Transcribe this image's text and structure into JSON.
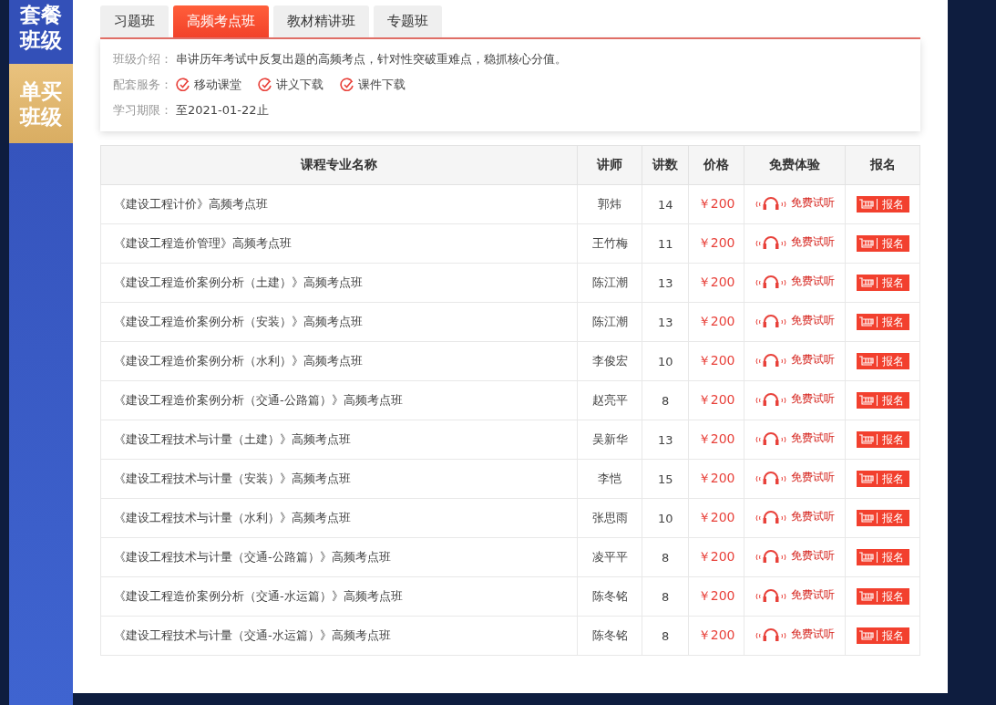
{
  "sidebar": {
    "items": [
      {
        "label": "套餐班级",
        "selected": false
      },
      {
        "label": "单买班级",
        "selected": true
      }
    ]
  },
  "tabs": [
    {
      "label": "习题班",
      "selected": false
    },
    {
      "label": "高频考点班",
      "selected": true
    },
    {
      "label": "教材精讲班",
      "selected": false
    },
    {
      "label": "专题班",
      "selected": false
    }
  ],
  "info": {
    "intro_label": "班级介绍：",
    "intro": "串讲历年考试中反复出题的高频考点，针对性突破重难点，稳抓核心分值。",
    "services_label": "配套服务：",
    "services": [
      "移动课堂",
      "讲义下载",
      "课件下载"
    ],
    "period_label": "学习期限：",
    "period": "至2021-01-22止"
  },
  "table": {
    "columns": [
      "课程专业名称",
      "讲师",
      "讲数",
      "价格",
      "免费体验",
      "报名"
    ],
    "rows": [
      {
        "name": "《建设工程计价》高频考点班",
        "teacher": "郭炜",
        "lessons": "14",
        "price": "￥200",
        "trial": "免费试听",
        "signup": "报名"
      },
      {
        "name": "《建设工程造价管理》高频考点班",
        "teacher": "王竹梅",
        "lessons": "11",
        "price": "￥200",
        "trial": "免费试听",
        "signup": "报名"
      },
      {
        "name": "《建设工程造价案例分析（土建）》高频考点班",
        "teacher": "陈江潮",
        "lessons": "13",
        "price": "￥200",
        "trial": "免费试听",
        "signup": "报名"
      },
      {
        "name": "《建设工程造价案例分析（安装）》高频考点班",
        "teacher": "陈江潮",
        "lessons": "13",
        "price": "￥200",
        "trial": "免费试听",
        "signup": "报名"
      },
      {
        "name": "《建设工程造价案例分析（水利）》高频考点班",
        "teacher": "李俊宏",
        "lessons": "10",
        "price": "￥200",
        "trial": "免费试听",
        "signup": "报名"
      },
      {
        "name": "《建设工程造价案例分析（交通-公路篇）》高频考点班",
        "teacher": "赵亮平",
        "lessons": "8",
        "price": "￥200",
        "trial": "免费试听",
        "signup": "报名"
      },
      {
        "name": "《建设工程技术与计量（土建）》高频考点班",
        "teacher": "吴新华",
        "lessons": "13",
        "price": "￥200",
        "trial": "免费试听",
        "signup": "报名"
      },
      {
        "name": "《建设工程技术与计量（安装）》高频考点班",
        "teacher": "李恺",
        "lessons": "15",
        "price": "￥200",
        "trial": "免费试听",
        "signup": "报名"
      },
      {
        "name": "《建设工程技术与计量（水利）》高频考点班",
        "teacher": "张思雨",
        "lessons": "10",
        "price": "￥200",
        "trial": "免费试听",
        "signup": "报名"
      },
      {
        "name": "《建设工程技术与计量（交通-公路篇）》高频考点班",
        "teacher": "凌平平",
        "lessons": "8",
        "price": "￥200",
        "trial": "免费试听",
        "signup": "报名"
      },
      {
        "name": "《建设工程造价案例分析（交通-水运篇）》高频考点班",
        "teacher": "陈冬铭",
        "lessons": "8",
        "price": "￥200",
        "trial": "免费试听",
        "signup": "报名"
      },
      {
        "name": "《建设工程技术与计量（交通-水运篇）》高频考点班",
        "teacher": "陈冬铭",
        "lessons": "8",
        "price": "￥200",
        "trial": "免费试听",
        "signup": "报名"
      }
    ]
  }
}
